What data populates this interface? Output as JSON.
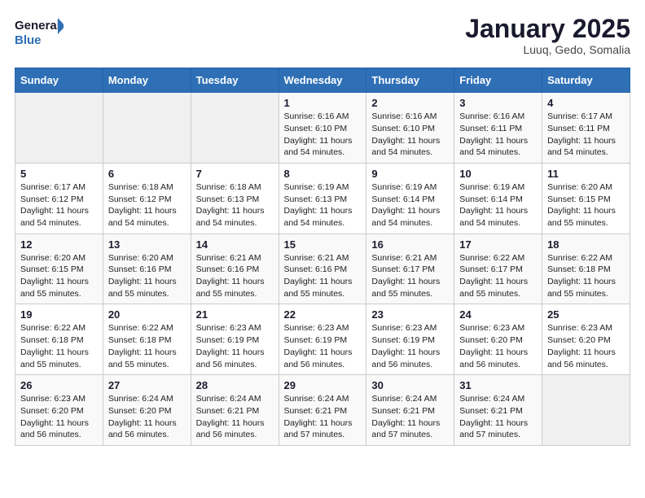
{
  "header": {
    "logo_general": "General",
    "logo_blue": "Blue",
    "title": "January 2025",
    "subtitle": "Luuq, Gedo, Somalia"
  },
  "days_of_week": [
    "Sunday",
    "Monday",
    "Tuesday",
    "Wednesday",
    "Thursday",
    "Friday",
    "Saturday"
  ],
  "weeks": [
    [
      {
        "day": "",
        "info": ""
      },
      {
        "day": "",
        "info": ""
      },
      {
        "day": "",
        "info": ""
      },
      {
        "day": "1",
        "info": "Sunrise: 6:16 AM\nSunset: 6:10 PM\nDaylight: 11 hours and 54 minutes."
      },
      {
        "day": "2",
        "info": "Sunrise: 6:16 AM\nSunset: 6:10 PM\nDaylight: 11 hours and 54 minutes."
      },
      {
        "day": "3",
        "info": "Sunrise: 6:16 AM\nSunset: 6:11 PM\nDaylight: 11 hours and 54 minutes."
      },
      {
        "day": "4",
        "info": "Sunrise: 6:17 AM\nSunset: 6:11 PM\nDaylight: 11 hours and 54 minutes."
      }
    ],
    [
      {
        "day": "5",
        "info": "Sunrise: 6:17 AM\nSunset: 6:12 PM\nDaylight: 11 hours and 54 minutes."
      },
      {
        "day": "6",
        "info": "Sunrise: 6:18 AM\nSunset: 6:12 PM\nDaylight: 11 hours and 54 minutes."
      },
      {
        "day": "7",
        "info": "Sunrise: 6:18 AM\nSunset: 6:13 PM\nDaylight: 11 hours and 54 minutes."
      },
      {
        "day": "8",
        "info": "Sunrise: 6:19 AM\nSunset: 6:13 PM\nDaylight: 11 hours and 54 minutes."
      },
      {
        "day": "9",
        "info": "Sunrise: 6:19 AM\nSunset: 6:14 PM\nDaylight: 11 hours and 54 minutes."
      },
      {
        "day": "10",
        "info": "Sunrise: 6:19 AM\nSunset: 6:14 PM\nDaylight: 11 hours and 54 minutes."
      },
      {
        "day": "11",
        "info": "Sunrise: 6:20 AM\nSunset: 6:15 PM\nDaylight: 11 hours and 55 minutes."
      }
    ],
    [
      {
        "day": "12",
        "info": "Sunrise: 6:20 AM\nSunset: 6:15 PM\nDaylight: 11 hours and 55 minutes."
      },
      {
        "day": "13",
        "info": "Sunrise: 6:20 AM\nSunset: 6:16 PM\nDaylight: 11 hours and 55 minutes."
      },
      {
        "day": "14",
        "info": "Sunrise: 6:21 AM\nSunset: 6:16 PM\nDaylight: 11 hours and 55 minutes."
      },
      {
        "day": "15",
        "info": "Sunrise: 6:21 AM\nSunset: 6:16 PM\nDaylight: 11 hours and 55 minutes."
      },
      {
        "day": "16",
        "info": "Sunrise: 6:21 AM\nSunset: 6:17 PM\nDaylight: 11 hours and 55 minutes."
      },
      {
        "day": "17",
        "info": "Sunrise: 6:22 AM\nSunset: 6:17 PM\nDaylight: 11 hours and 55 minutes."
      },
      {
        "day": "18",
        "info": "Sunrise: 6:22 AM\nSunset: 6:18 PM\nDaylight: 11 hours and 55 minutes."
      }
    ],
    [
      {
        "day": "19",
        "info": "Sunrise: 6:22 AM\nSunset: 6:18 PM\nDaylight: 11 hours and 55 minutes."
      },
      {
        "day": "20",
        "info": "Sunrise: 6:22 AM\nSunset: 6:18 PM\nDaylight: 11 hours and 55 minutes."
      },
      {
        "day": "21",
        "info": "Sunrise: 6:23 AM\nSunset: 6:19 PM\nDaylight: 11 hours and 56 minutes."
      },
      {
        "day": "22",
        "info": "Sunrise: 6:23 AM\nSunset: 6:19 PM\nDaylight: 11 hours and 56 minutes."
      },
      {
        "day": "23",
        "info": "Sunrise: 6:23 AM\nSunset: 6:19 PM\nDaylight: 11 hours and 56 minutes."
      },
      {
        "day": "24",
        "info": "Sunrise: 6:23 AM\nSunset: 6:20 PM\nDaylight: 11 hours and 56 minutes."
      },
      {
        "day": "25",
        "info": "Sunrise: 6:23 AM\nSunset: 6:20 PM\nDaylight: 11 hours and 56 minutes."
      }
    ],
    [
      {
        "day": "26",
        "info": "Sunrise: 6:23 AM\nSunset: 6:20 PM\nDaylight: 11 hours and 56 minutes."
      },
      {
        "day": "27",
        "info": "Sunrise: 6:24 AM\nSunset: 6:20 PM\nDaylight: 11 hours and 56 minutes."
      },
      {
        "day": "28",
        "info": "Sunrise: 6:24 AM\nSunset: 6:21 PM\nDaylight: 11 hours and 56 minutes."
      },
      {
        "day": "29",
        "info": "Sunrise: 6:24 AM\nSunset: 6:21 PM\nDaylight: 11 hours and 57 minutes."
      },
      {
        "day": "30",
        "info": "Sunrise: 6:24 AM\nSunset: 6:21 PM\nDaylight: 11 hours and 57 minutes."
      },
      {
        "day": "31",
        "info": "Sunrise: 6:24 AM\nSunset: 6:21 PM\nDaylight: 11 hours and 57 minutes."
      },
      {
        "day": "",
        "info": ""
      }
    ]
  ]
}
